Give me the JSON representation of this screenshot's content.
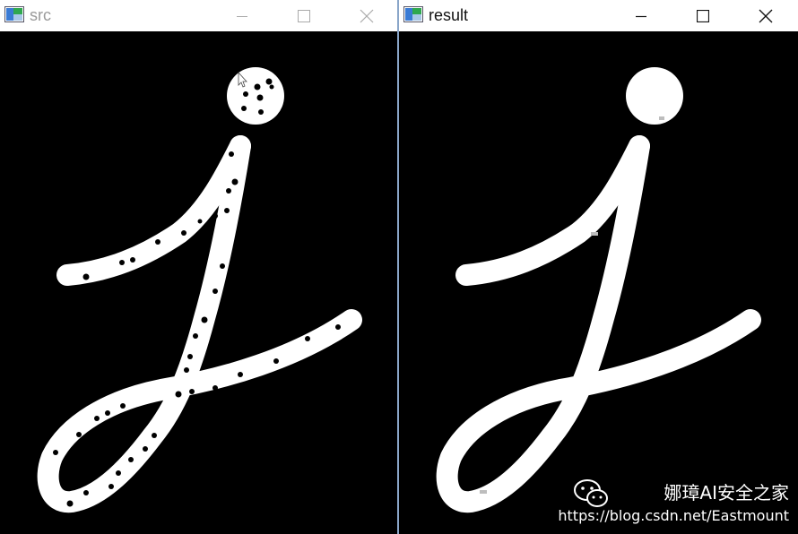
{
  "windows": {
    "src": {
      "title": "src"
    },
    "result": {
      "title": "result"
    }
  },
  "icons": {
    "app": "opencv-window-icon",
    "minimize": "minimize-icon",
    "maximize": "maximize-icon",
    "close": "close-icon",
    "wechat": "wechat-icon"
  },
  "watermark": {
    "brand": "娜璋AI安全之家",
    "url": "https://blog.csdn.net/Eastmount"
  },
  "colors": {
    "image_background": "#000000",
    "stroke": "#ffffff",
    "window_border": "#8aa6c9"
  }
}
